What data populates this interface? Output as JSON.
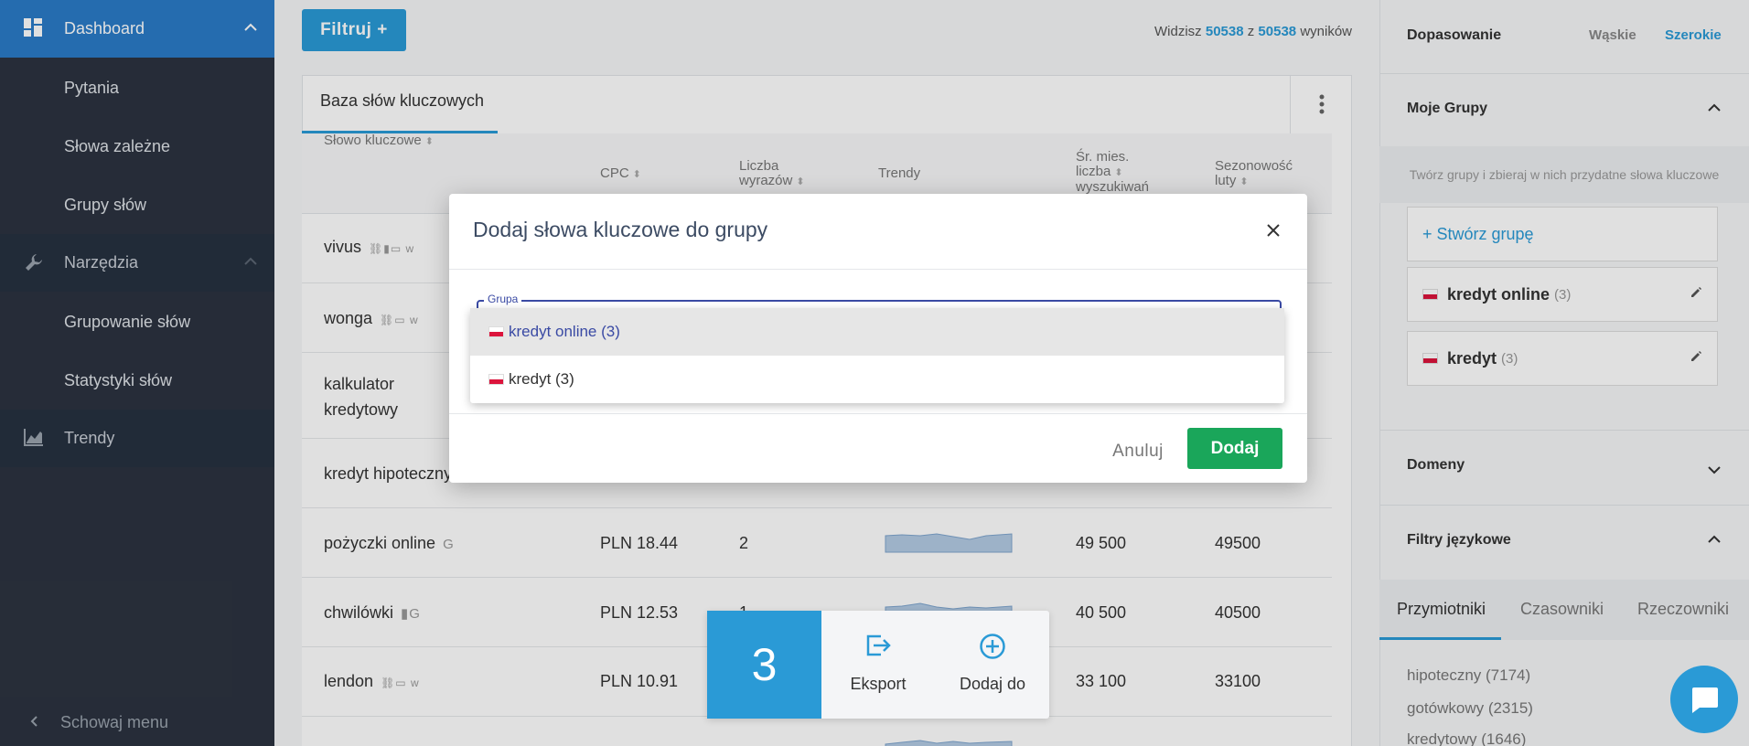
{
  "sidebar": {
    "dashboard": "Dashboard",
    "pytania": "Pytania",
    "slowa_zalezne": "Słowa zależne",
    "grupy_slow": "Grupy słów",
    "narzedzia": "Narzędzia",
    "grupowanie": "Grupowanie słów",
    "statystyki": "Statystyki słów",
    "trendy": "Trendy",
    "collapse": "Schowaj menu"
  },
  "toolbar": {
    "filter_label": "Filtruj +",
    "results_prefix": "Widzisz",
    "results_shown": "50538",
    "results_of": "z",
    "results_total": "50538",
    "results_suffix": "wyników"
  },
  "table": {
    "tab_label": "Baza słów kluczowych",
    "columns": {
      "keyword": "Słowo kluczowe",
      "cpc": "CPC",
      "words_1": "Liczba",
      "words_2": "wyrazów",
      "trends": "Trendy",
      "avg_1": "Śr. mies.",
      "avg_2": "liczba",
      "avg_3": "wyszukiwań",
      "season_1": "Sezonowość",
      "season_2": "luty"
    },
    "rows": [
      {
        "keyword": "vivus",
        "icons": "⛓▮▭ w",
        "cpc": "",
        "words": "",
        "avg": "",
        "season": ""
      },
      {
        "keyword": "wonga",
        "icons": "⛓▭ w",
        "cpc": "",
        "words": "",
        "avg": "",
        "season": ""
      },
      {
        "keyword": "kalkulator",
        "keyword_2": "kredytowy",
        "icons": "",
        "cpc": "",
        "words": "",
        "avg": "",
        "season": ""
      },
      {
        "keyword": "kredyt hipoteczny",
        "icons": "",
        "cpc": "",
        "words": "",
        "avg": "",
        "season": ""
      },
      {
        "keyword": "pożyczki online",
        "icons": "G",
        "cpc": "PLN 18.44",
        "words": "2",
        "avg": "49 500",
        "season": "49500"
      },
      {
        "keyword": "chwilówki",
        "icons": "▮G",
        "cpc": "PLN 12.53",
        "words": "1",
        "avg": "40 500",
        "season": "40500"
      },
      {
        "keyword": "lendon",
        "icons": "⛓▭ w",
        "cpc": "PLN 10.91",
        "words": "",
        "avg": "33 100",
        "season": "33100"
      }
    ]
  },
  "modal": {
    "title": "Dodaj słowa kluczowe do grupy",
    "field_label": "Grupa",
    "options": [
      "kredyt online (3)",
      "kredyt (3)"
    ],
    "cancel": "Anuluj",
    "add": "Dodaj"
  },
  "bottombar": {
    "count": "3",
    "export": "Eksport",
    "add_to": "Dodaj do"
  },
  "right_panel": {
    "fit_title": "Dopasowanie",
    "fit_narrow": "Wąskie",
    "fit_wide": "Szerokie",
    "my_groups": "Moje Grupy",
    "hint": "Twórz grupy i zbieraj w nich przydatne słowa kluczowe",
    "create_group": "+ Stwórz grupę",
    "groups": [
      {
        "name": "kredyt online",
        "count": "(3)"
      },
      {
        "name": "kredyt",
        "count": "(3)"
      }
    ],
    "domains": "Domeny",
    "lang_filters": "Filtry językowe",
    "tabs": [
      "Przymiotniki",
      "Czasowniki",
      "Rzeczowniki"
    ],
    "adjectives": [
      "hipoteczny (7174)",
      "gotówkowy (2315)",
      "kredytowy (1646)"
    ]
  },
  "colors": {
    "accent": "#2a9ad6",
    "sidebar_bg": "#2c3340",
    "add_button": "#1aa65a",
    "field_focus": "#3a4aa4"
  },
  "icons": [
    "dashboard-icon",
    "wrench-icon",
    "chart-icon",
    "close-icon",
    "export-icon",
    "plus-circle-icon",
    "pencil-icon",
    "chat-icon",
    "chevron-up-icon",
    "chevron-down-icon",
    "more-vertical-icon",
    "chevron-left-icon"
  ]
}
